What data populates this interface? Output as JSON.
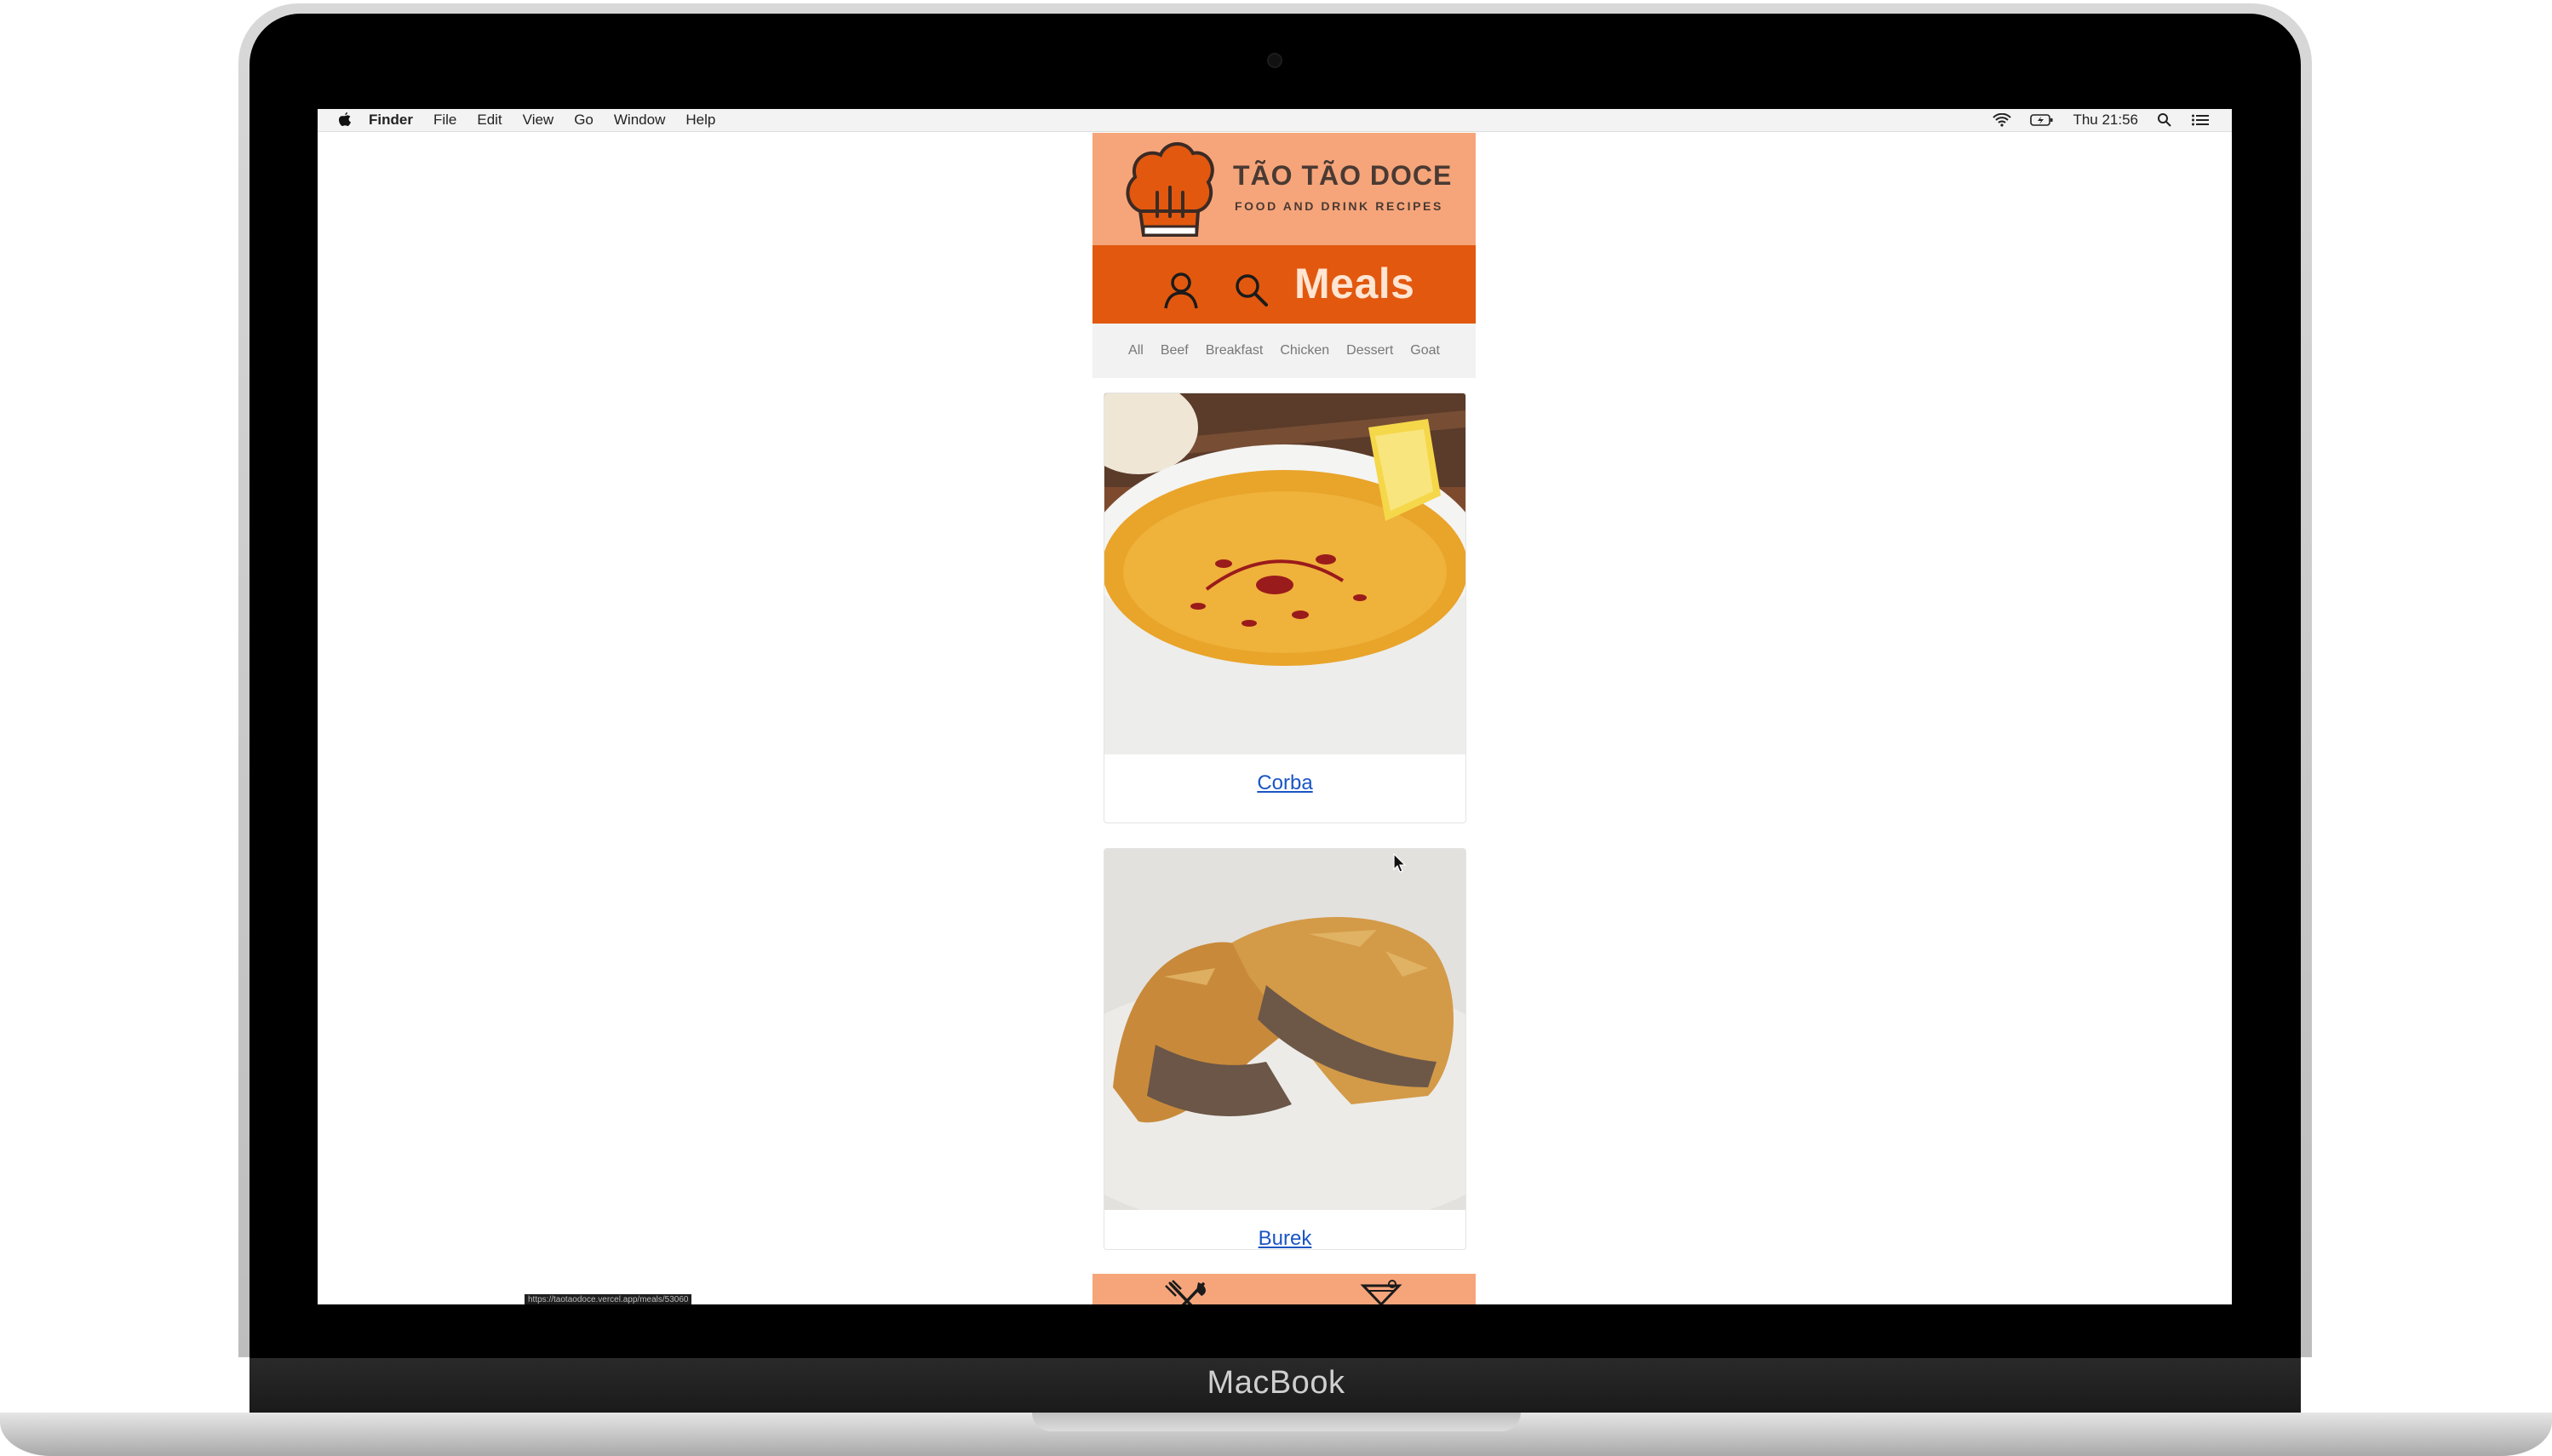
{
  "device": {
    "brand_label": "MacBook"
  },
  "menubar": {
    "app_name": "Finder",
    "items": [
      "File",
      "Edit",
      "View",
      "Go",
      "Window",
      "Help"
    ],
    "clock": "Thu 21:56",
    "icons": [
      "apple-icon",
      "wifi-icon",
      "battery-icon",
      "spotlight-icon",
      "notification-center-icon"
    ]
  },
  "app": {
    "brand_title": "TÃO TÃO DOCE",
    "brand_subtitle": "FOOD AND DRINK RECIPES",
    "page_heading": "Meals",
    "nav_icons": [
      "user-icon",
      "search-icon"
    ],
    "categories": [
      "All",
      "Beef",
      "Breakfast",
      "Chicken",
      "Dessert",
      "Goat"
    ],
    "meals": [
      {
        "name": "Corba"
      },
      {
        "name": "Burek"
      }
    ],
    "bottom_nav": [
      "fork-knife-icon",
      "cocktail-icon"
    ]
  },
  "colors": {
    "logo_band": "#f6a57a",
    "nav_band": "#e2580f",
    "link": "#1a55c4"
  },
  "status_bar": {
    "url": "https://taotaodoce.vercel.app/meals/53060"
  }
}
